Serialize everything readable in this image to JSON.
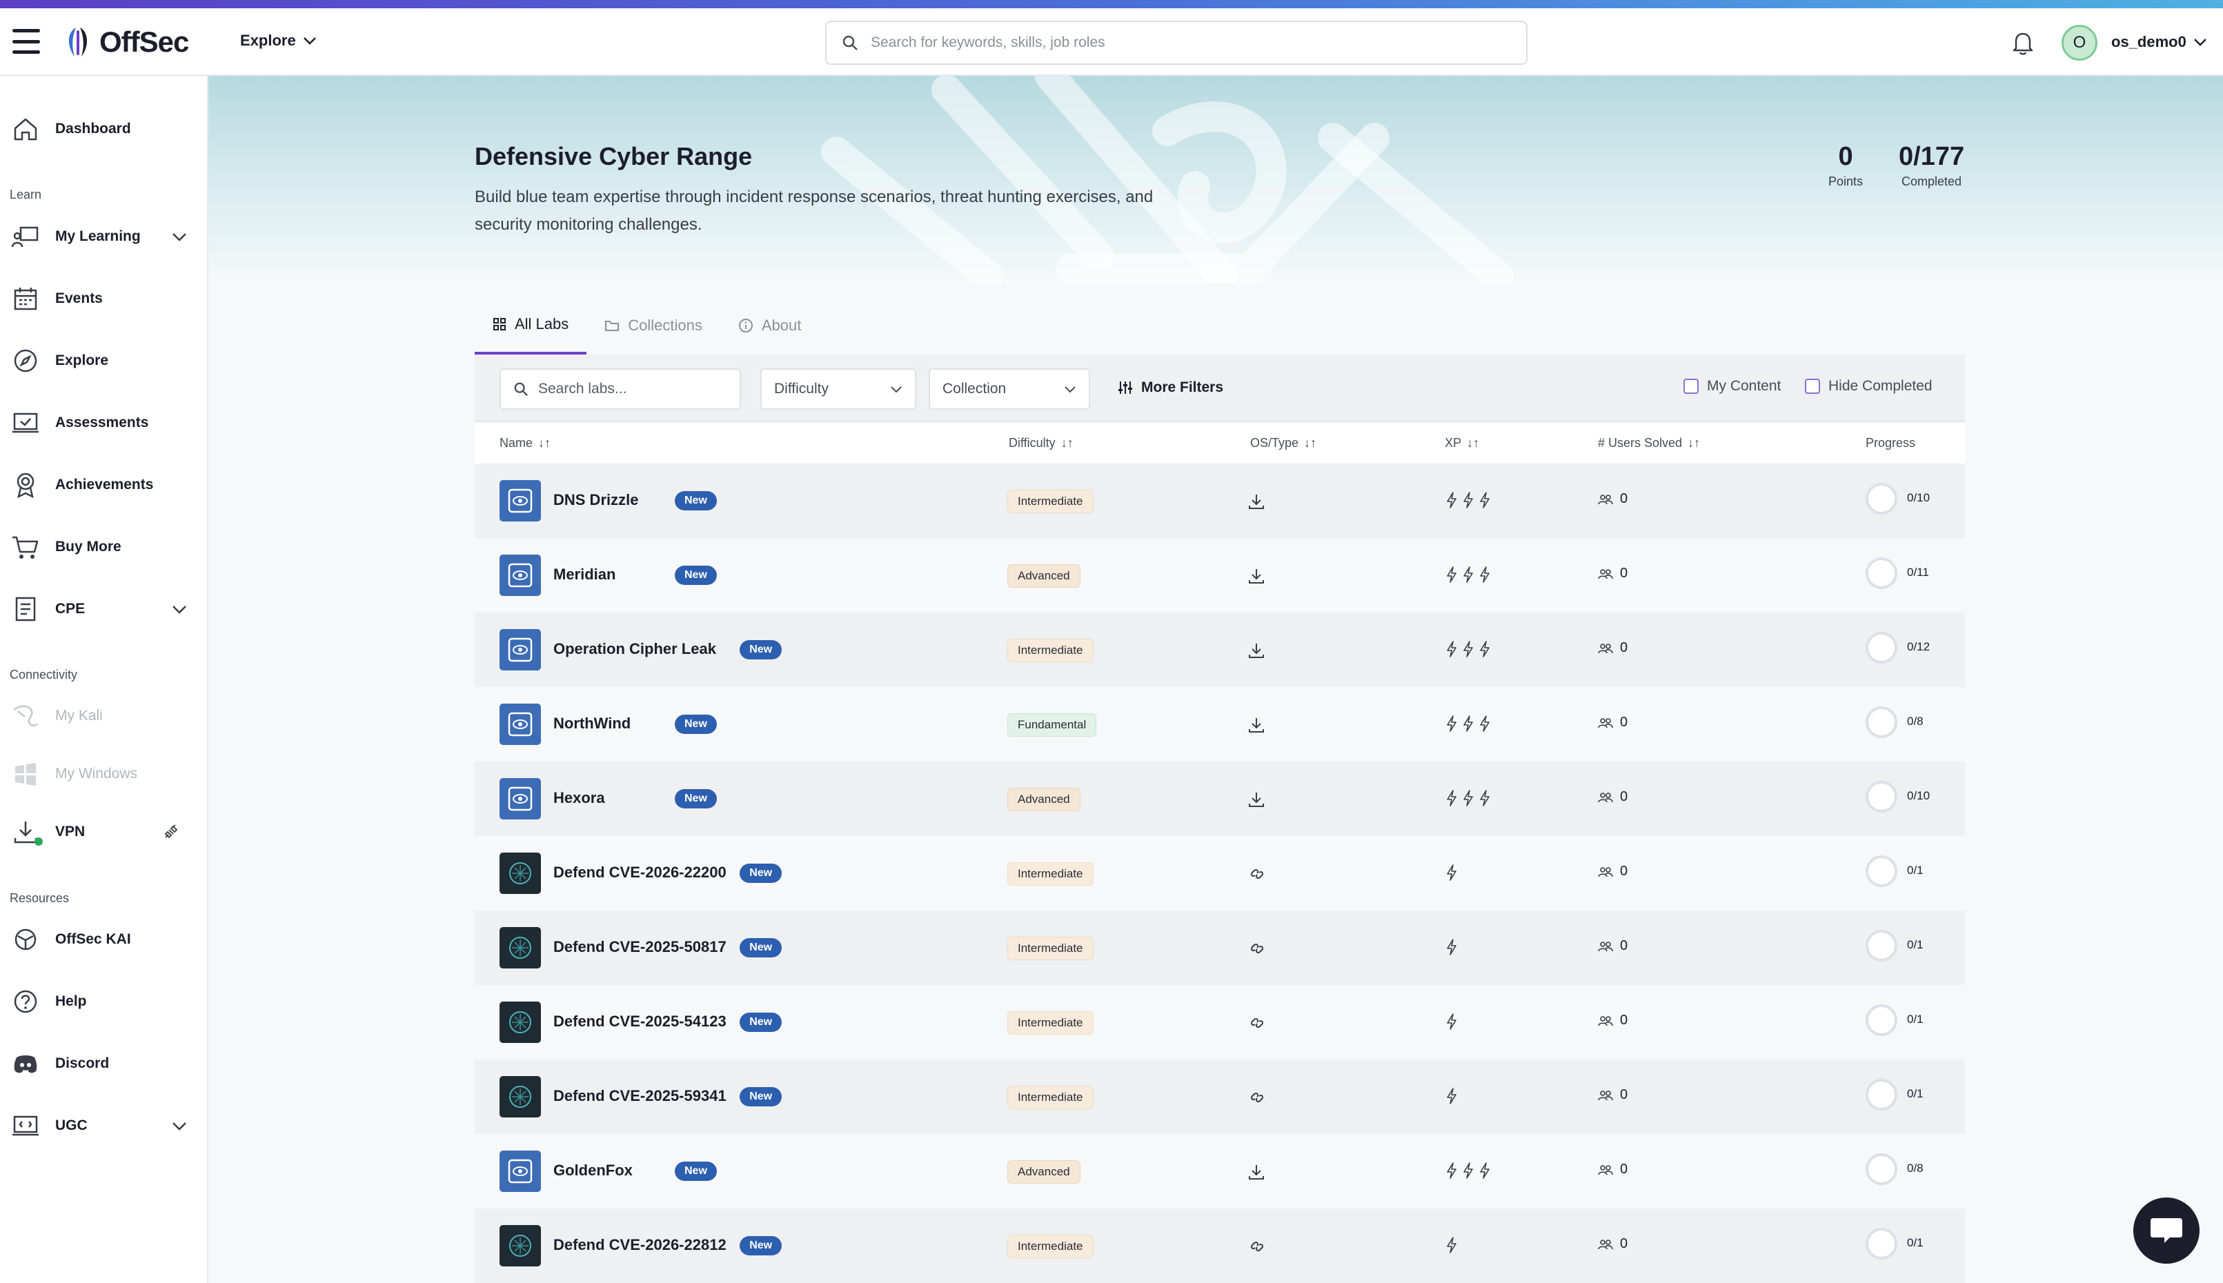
{
  "header": {
    "logo_text": "OffSec",
    "explore_label": "Explore",
    "search_placeholder": "Search for keywords, skills, job roles",
    "avatar_initial": "O",
    "username": "os_demo0"
  },
  "sidebar": {
    "dashboard": "Dashboard",
    "section_learn": "Learn",
    "my_learning": "My Learning",
    "events": "Events",
    "explore": "Explore",
    "assessments": "Assessments",
    "achievements": "Achievements",
    "buy_more": "Buy More",
    "cpe": "CPE",
    "section_connectivity": "Connectivity",
    "my_kali": "My Kali",
    "my_windows": "My Windows",
    "vpn": "VPN",
    "section_resources": "Resources",
    "offsec_kai": "OffSec KAI",
    "help": "Help",
    "discord": "Discord",
    "ugc": "UGC"
  },
  "hero": {
    "title": "Defensive Cyber Range",
    "description": "Build blue team expertise through incident response scenarios, threat hunting exercises, and security monitoring challenges.",
    "points_value": "0",
    "points_label": "Points",
    "completed_value": "0/177",
    "completed_label": "Completed"
  },
  "tabs": {
    "all_labs": "All Labs",
    "collections": "Collections",
    "about": "About"
  },
  "filters": {
    "search_placeholder": "Search labs...",
    "difficulty": "Difficulty",
    "collection": "Collection",
    "more_filters": "More Filters",
    "my_content": "My Content",
    "hide_completed": "Hide Completed"
  },
  "table": {
    "headers": {
      "name": "Name",
      "difficulty": "Difficulty",
      "os_type": "OS/Type",
      "xp": "XP",
      "users_solved": "# Users Solved",
      "progress": "Progress"
    },
    "new_badge": "New",
    "rows": [
      {
        "name": "DNS Drizzle",
        "difficulty": "Intermediate",
        "type": "download",
        "xp": 3,
        "solved": "0",
        "progress": "0/10",
        "thumb": "blue"
      },
      {
        "name": "Meridian",
        "difficulty": "Advanced",
        "type": "download",
        "xp": 3,
        "solved": "0",
        "progress": "0/11",
        "thumb": "blue"
      },
      {
        "name": "Operation Cipher Leak",
        "difficulty": "Intermediate",
        "type": "download",
        "xp": 3,
        "solved": "0",
        "progress": "0/12",
        "thumb": "blue"
      },
      {
        "name": "NorthWind",
        "difficulty": "Fundamental",
        "type": "download",
        "xp": 3,
        "solved": "0",
        "progress": "0/8",
        "thumb": "blue"
      },
      {
        "name": "Hexora",
        "difficulty": "Advanced",
        "type": "download",
        "xp": 3,
        "solved": "0",
        "progress": "0/10",
        "thumb": "blue"
      },
      {
        "name": "Defend CVE-2026-22200",
        "difficulty": "Intermediate",
        "type": "link",
        "xp": 1,
        "solved": "0",
        "progress": "0/1",
        "thumb": "dark"
      },
      {
        "name": "Defend CVE-2025-50817",
        "difficulty": "Intermediate",
        "type": "link",
        "xp": 1,
        "solved": "0",
        "progress": "0/1",
        "thumb": "dark"
      },
      {
        "name": "Defend CVE-2025-54123",
        "difficulty": "Intermediate",
        "type": "link",
        "xp": 1,
        "solved": "0",
        "progress": "0/1",
        "thumb": "dark"
      },
      {
        "name": "Defend CVE-2025-59341",
        "difficulty": "Intermediate",
        "type": "link",
        "xp": 1,
        "solved": "0",
        "progress": "0/1",
        "thumb": "dark"
      },
      {
        "name": "GoldenFox",
        "difficulty": "Advanced",
        "type": "download",
        "xp": 3,
        "solved": "0",
        "progress": "0/8",
        "thumb": "blue"
      },
      {
        "name": "Defend CVE-2026-22812",
        "difficulty": "Intermediate",
        "type": "link",
        "xp": 1,
        "solved": "0",
        "progress": "0/1",
        "thumb": "dark"
      }
    ]
  },
  "colors": {
    "accent": "#6b3fc9",
    "badge_blue": "#2d5fb0",
    "vpn_connected": "#2ca85a"
  }
}
